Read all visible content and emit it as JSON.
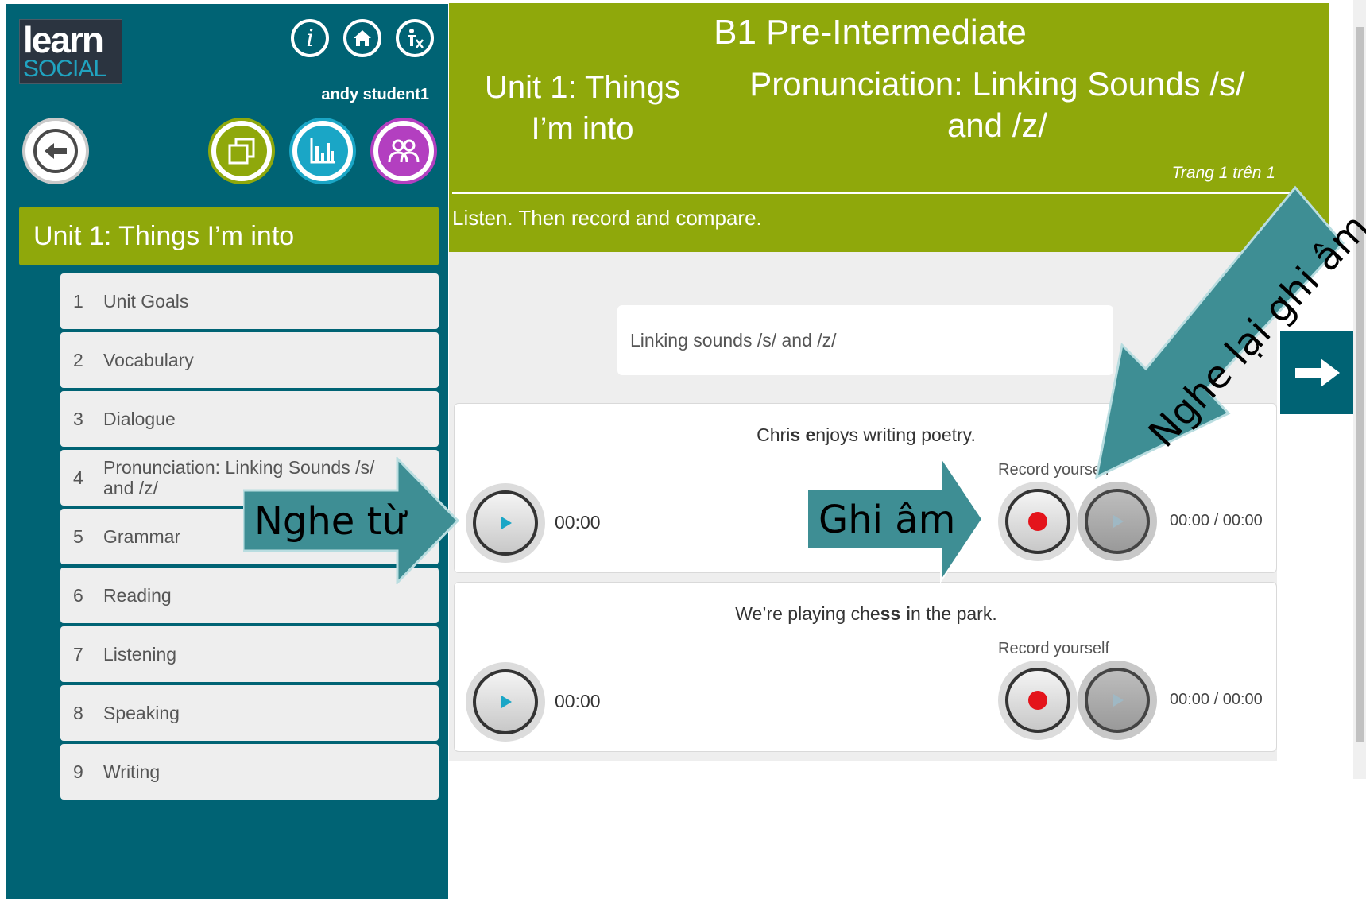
{
  "brand": {
    "line1": "learn",
    "line2": "SOCIAL"
  },
  "user": {
    "name": "andy student1"
  },
  "sidebar": {
    "unit_title": "Unit 1: Things I’m into",
    "items": [
      {
        "num": "1",
        "label": "Unit Goals"
      },
      {
        "num": "2",
        "label": "Vocabulary"
      },
      {
        "num": "3",
        "label": "Dialogue"
      },
      {
        "num": "4",
        "label": "Pronunciation: Linking Sounds /s/ and /z/"
      },
      {
        "num": "5",
        "label": "Grammar"
      },
      {
        "num": "6",
        "label": "Reading"
      },
      {
        "num": "7",
        "label": "Listening"
      },
      {
        "num": "8",
        "label": "Speaking"
      },
      {
        "num": "9",
        "label": "Writing"
      }
    ]
  },
  "header": {
    "course": "B1 Pre-Intermediate",
    "unit": "Unit 1: Things I’m into",
    "lesson": "Pronunciation: Linking Sounds /s/ and /z/",
    "page_indicator": "Trang 1 trên 1",
    "instruction": "Listen. Then record and compare."
  },
  "content": {
    "word_box": "Linking sounds /s/ and /z/",
    "items": [
      {
        "sentence_parts": [
          {
            "text": "Chri",
            "bold": false
          },
          {
            "text": "s",
            "bold": true
          },
          {
            "text": " ",
            "bold": false
          },
          {
            "text": "e",
            "bold": true
          },
          {
            "text": "njoys writing poetry.",
            "bold": false
          }
        ],
        "time": "00:00",
        "record_label": "Record yourself",
        "record_time": "00:00 / 00:00"
      },
      {
        "sentence_parts": [
          {
            "text": "We’re playing che",
            "bold": false
          },
          {
            "text": "ss",
            "bold": true
          },
          {
            "text": " ",
            "bold": false
          },
          {
            "text": "i",
            "bold": true
          },
          {
            "text": "n the park.",
            "bold": false
          }
        ],
        "time": "00:00",
        "record_label": "Record yourself",
        "record_time": "00:00 / 00:00"
      }
    ]
  },
  "annotations": {
    "listen": "Nghe từ",
    "record": "Ghi âm",
    "replay": "Nghe lại ghi âm"
  },
  "colors": {
    "teal": "#006374",
    "green": "#8fa80b",
    "callout": "#3e8e94",
    "record_red": "#e4141b",
    "play_blue": "#1aa6c6"
  },
  "icons": [
    "info-icon",
    "home-icon",
    "accessibility-icon",
    "back-arrow-icon",
    "copy-icon",
    "bar-chart-icon",
    "people-icon",
    "play-icon",
    "record-icon",
    "next-arrow-icon"
  ]
}
